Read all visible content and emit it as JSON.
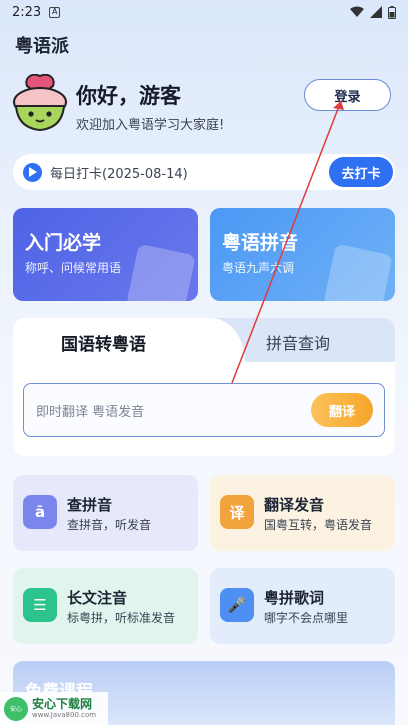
{
  "status_bar": {
    "time": "2:23",
    "notif_glyph": "A"
  },
  "app": {
    "title": "粤语派"
  },
  "profile": {
    "greeting": "你好，游客",
    "welcome": "欢迎加入粤语学习大家庭!",
    "login_label": "登录"
  },
  "checkin": {
    "text": "每日打卡(2025-08-14)",
    "button": "去打卡"
  },
  "cards": [
    {
      "title": "入门必学",
      "subtitle": "称呼、问候常用语",
      "deco": "☰"
    },
    {
      "title": "粤语拼音",
      "subtitle": "粤语九声六调",
      "deco": "á"
    }
  ],
  "translate": {
    "tabs": [
      "国语转粤语",
      "拼音查询"
    ],
    "placeholder": "即时翻译 粤语发音",
    "button": "翻译"
  },
  "features": [
    {
      "title": "查拼音",
      "subtitle": "查拼音，听发音",
      "icon_glyph": "ā",
      "color": "#7b86ec"
    },
    {
      "title": "翻译发音",
      "subtitle": "国粤互转，粤语发音",
      "icon_glyph": "译",
      "color": "#f3a33c"
    },
    {
      "title": "长文注音",
      "subtitle": "标粤拼，听标准发音",
      "icon_glyph": "☰",
      "color": "#2cc38d"
    },
    {
      "title": "粤拼歌词",
      "subtitle": "哪字不会点哪里",
      "icon_glyph": "🎤",
      "color": "#4d8ff2"
    }
  ],
  "free_course": {
    "title": "免费课程"
  },
  "watermark": {
    "main": "安心下载网",
    "sub": "www.Java800.com",
    "logo_text": "安心"
  },
  "colors": {
    "primary": "#2f6ff2",
    "accent": "#f6a52a"
  }
}
